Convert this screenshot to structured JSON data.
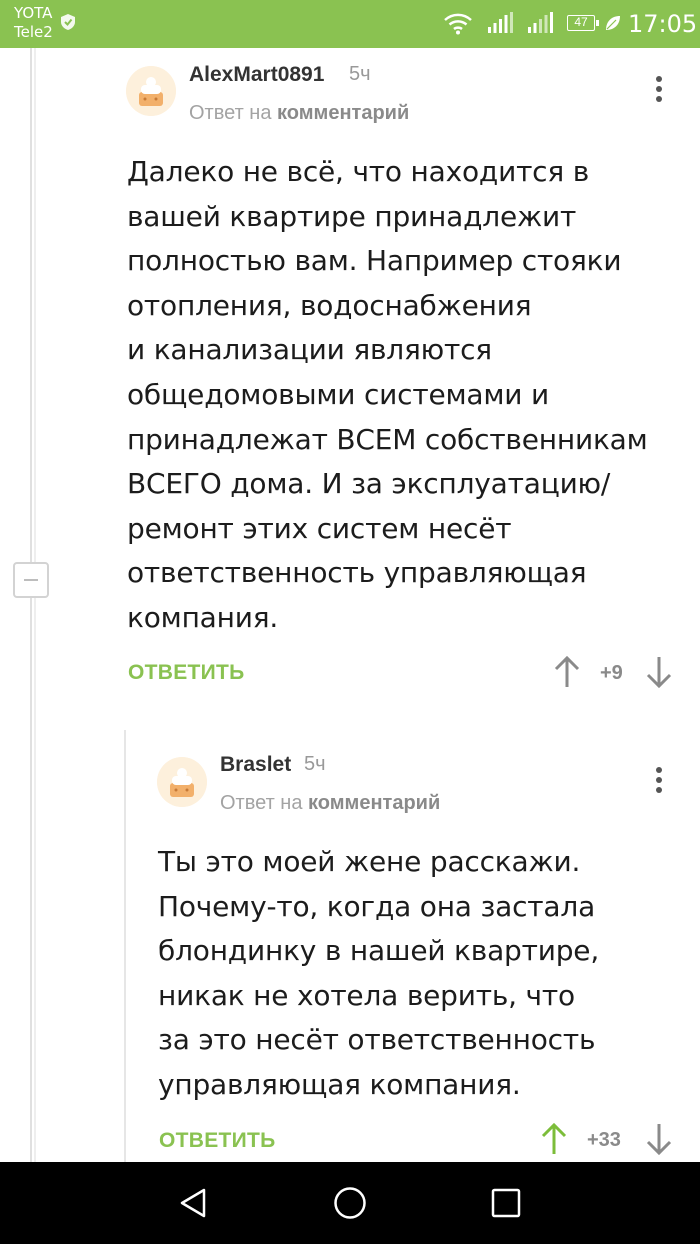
{
  "status_bar": {
    "carrier_1": "YOTA",
    "carrier_2": "Tele2",
    "battery": "47",
    "time": "17:05"
  },
  "comments": [
    {
      "author": "AlexMart0891",
      "time": "5ч",
      "reply_prefix": "Ответ на",
      "reply_target": "комментарий",
      "text": "Далеко не всё, что находится в\nвашей квартире принадлежит\nполностью вам. Например стояки\nотопления, водоснабжения\nи канализации являются\nобщедомовыми системами и\nпринадлежат ВСЕМ собственникам\nВСЕГО дома. И за эксплуатацию/\nремонт этих систем несёт\nответственность управляющая\nкомпания.",
      "reply_label": "ОТВЕТИТЬ",
      "rating": "+9"
    },
    {
      "author": "Braslet",
      "time": "5ч",
      "reply_prefix": "Ответ на",
      "reply_target": "комментарий",
      "text": "Ты это моей жене расскажи.\nПочему-то, когда она застала\nблондинку в нашей квартире,\nникак не хотела верить, что\nза это несёт ответственность\nуправляющая компания.",
      "reply_label": "ОТВЕТИТЬ",
      "rating": "+33"
    }
  ],
  "colors": {
    "accent": "#8ac251",
    "upvoted": "#7cbd3a",
    "text": "#1c1c1c",
    "muted": "#999999"
  },
  "icons": [
    "shield-icon",
    "wifi-icon",
    "signal-icon",
    "battery-icon",
    "leaf-icon",
    "more-icon",
    "arrow-up-icon",
    "arrow-down-icon",
    "back-icon",
    "home-icon",
    "recents-icon",
    "collapse-icon"
  ]
}
